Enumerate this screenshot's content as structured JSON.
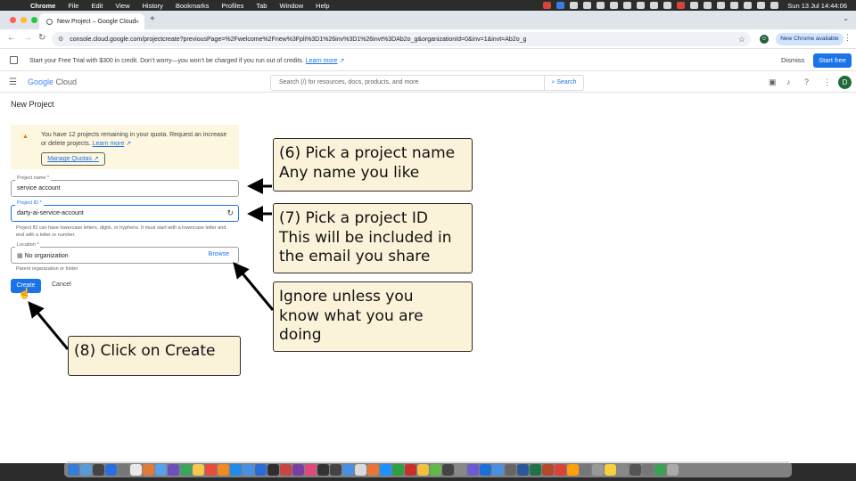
{
  "menubar": {
    "app": "Chrome",
    "items": [
      "File",
      "Edit",
      "View",
      "History",
      "Bookmarks",
      "Profiles",
      "Tab",
      "Window",
      "Help"
    ],
    "clock": "Sun 13 Jul  14:44:06"
  },
  "browser": {
    "tab_title": "New Project – Google Cloud",
    "tab_close": "×",
    "new_tab": "+",
    "url": "console.cloud.google.com/projectcreate?previousPage=%2Fwelcome%2Fnew%3Fpli%3D1%26inv%3D1%26invt%3DAb2o_g&organizationId=0&inv=1&invt=Ab2o_g",
    "profile_initial": "D",
    "update_label": "New Chrome available"
  },
  "trial_banner": {
    "text": "Start your Free Trial with $300 in credit. Don’t worry—you won’t be charged if you run out of credits.",
    "link": "Learn more",
    "dismiss": "Dismiss",
    "cta": "Start free"
  },
  "header": {
    "logo_g": "Google",
    "logo_cloud": " Cloud",
    "search_placeholder": "Search (/) for resources, docs, products, and more",
    "search_button": "Search",
    "avatar": "D"
  },
  "page": {
    "title": "New Project",
    "quota": {
      "text": "You have 12 projects remaining in your quota. Request an increase or delete projects.",
      "link": "Learn more",
      "button": "Manage Quotas"
    },
    "project_name": {
      "label": "Project name *",
      "value": "service account"
    },
    "project_id": {
      "label": "Project ID *",
      "value": "darty-ai-service-account",
      "helper": "Project ID can have lowercase letters, digits, or hyphens. It must start with a lowercase letter and end with a letter or number."
    },
    "location": {
      "label": "Location *",
      "value": "No organization",
      "browse": "Browse",
      "helper": "Parent organization or folder"
    },
    "create": "Create",
    "cancel": "Cancel"
  },
  "annotations": {
    "step6": "(6) Pick a project name\nAny name you like",
    "step7": "(7) Pick a project ID\nThis will be included in\nthe email you share",
    "ignore": "Ignore unless you\nknow what you are\ndoing",
    "step8": "(8) Click on Create"
  },
  "colors": {
    "accent": "#1a73e8",
    "callout_bg": "#fbf3d9",
    "warning_bg": "#fef7e0"
  }
}
